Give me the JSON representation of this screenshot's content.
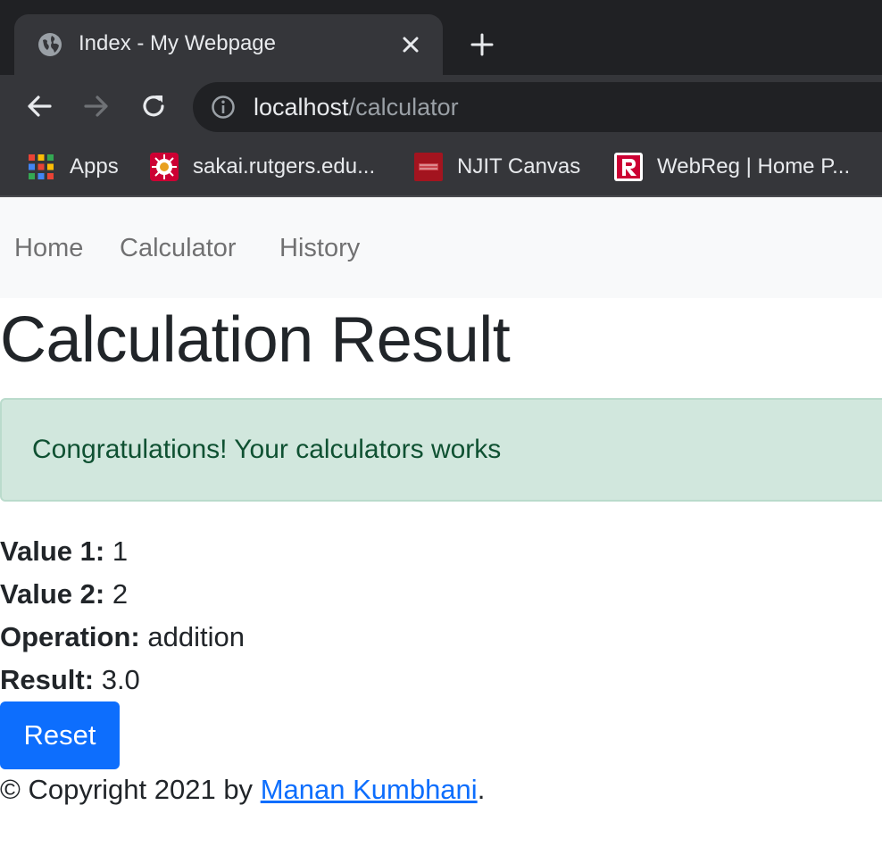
{
  "browser": {
    "tab": {
      "title": "Index - My Webpage",
      "favicon": "globe-icon"
    },
    "url": {
      "host": "localhost",
      "path": "/calculator"
    },
    "bookmarks": [
      {
        "label": "Apps",
        "icon": "apps-grid-icon"
      },
      {
        "label": "sakai.rutgers.edu...",
        "icon": "sakai-icon"
      },
      {
        "label": "NJIT Canvas",
        "icon": "njit-icon"
      },
      {
        "label": "WebReg | Home P...",
        "icon": "webreg-icon"
      }
    ]
  },
  "navbar": {
    "items": [
      {
        "label": "Home"
      },
      {
        "label": "Calculator"
      },
      {
        "label": "History"
      }
    ]
  },
  "page": {
    "title": "Calculation Result",
    "alert": "Congratulations! Your calculators works",
    "fields": [
      {
        "label": "Value 1:",
        "value": "1"
      },
      {
        "label": "Value 2:",
        "value": "2"
      },
      {
        "label": "Operation:",
        "value": "addition"
      },
      {
        "label": "Result:",
        "value": "3.0"
      }
    ],
    "reset_label": "Reset"
  },
  "footer": {
    "prefix": "© Copyright 2021 by",
    "author": "Manan Kumbhani",
    "suffix": "."
  },
  "colors": {
    "primary": "#0d6efd",
    "alert_bg": "#d1e7dd",
    "alert_text": "#0f5132",
    "chrome_dark": "#202124",
    "chrome_mid": "#35363a"
  }
}
